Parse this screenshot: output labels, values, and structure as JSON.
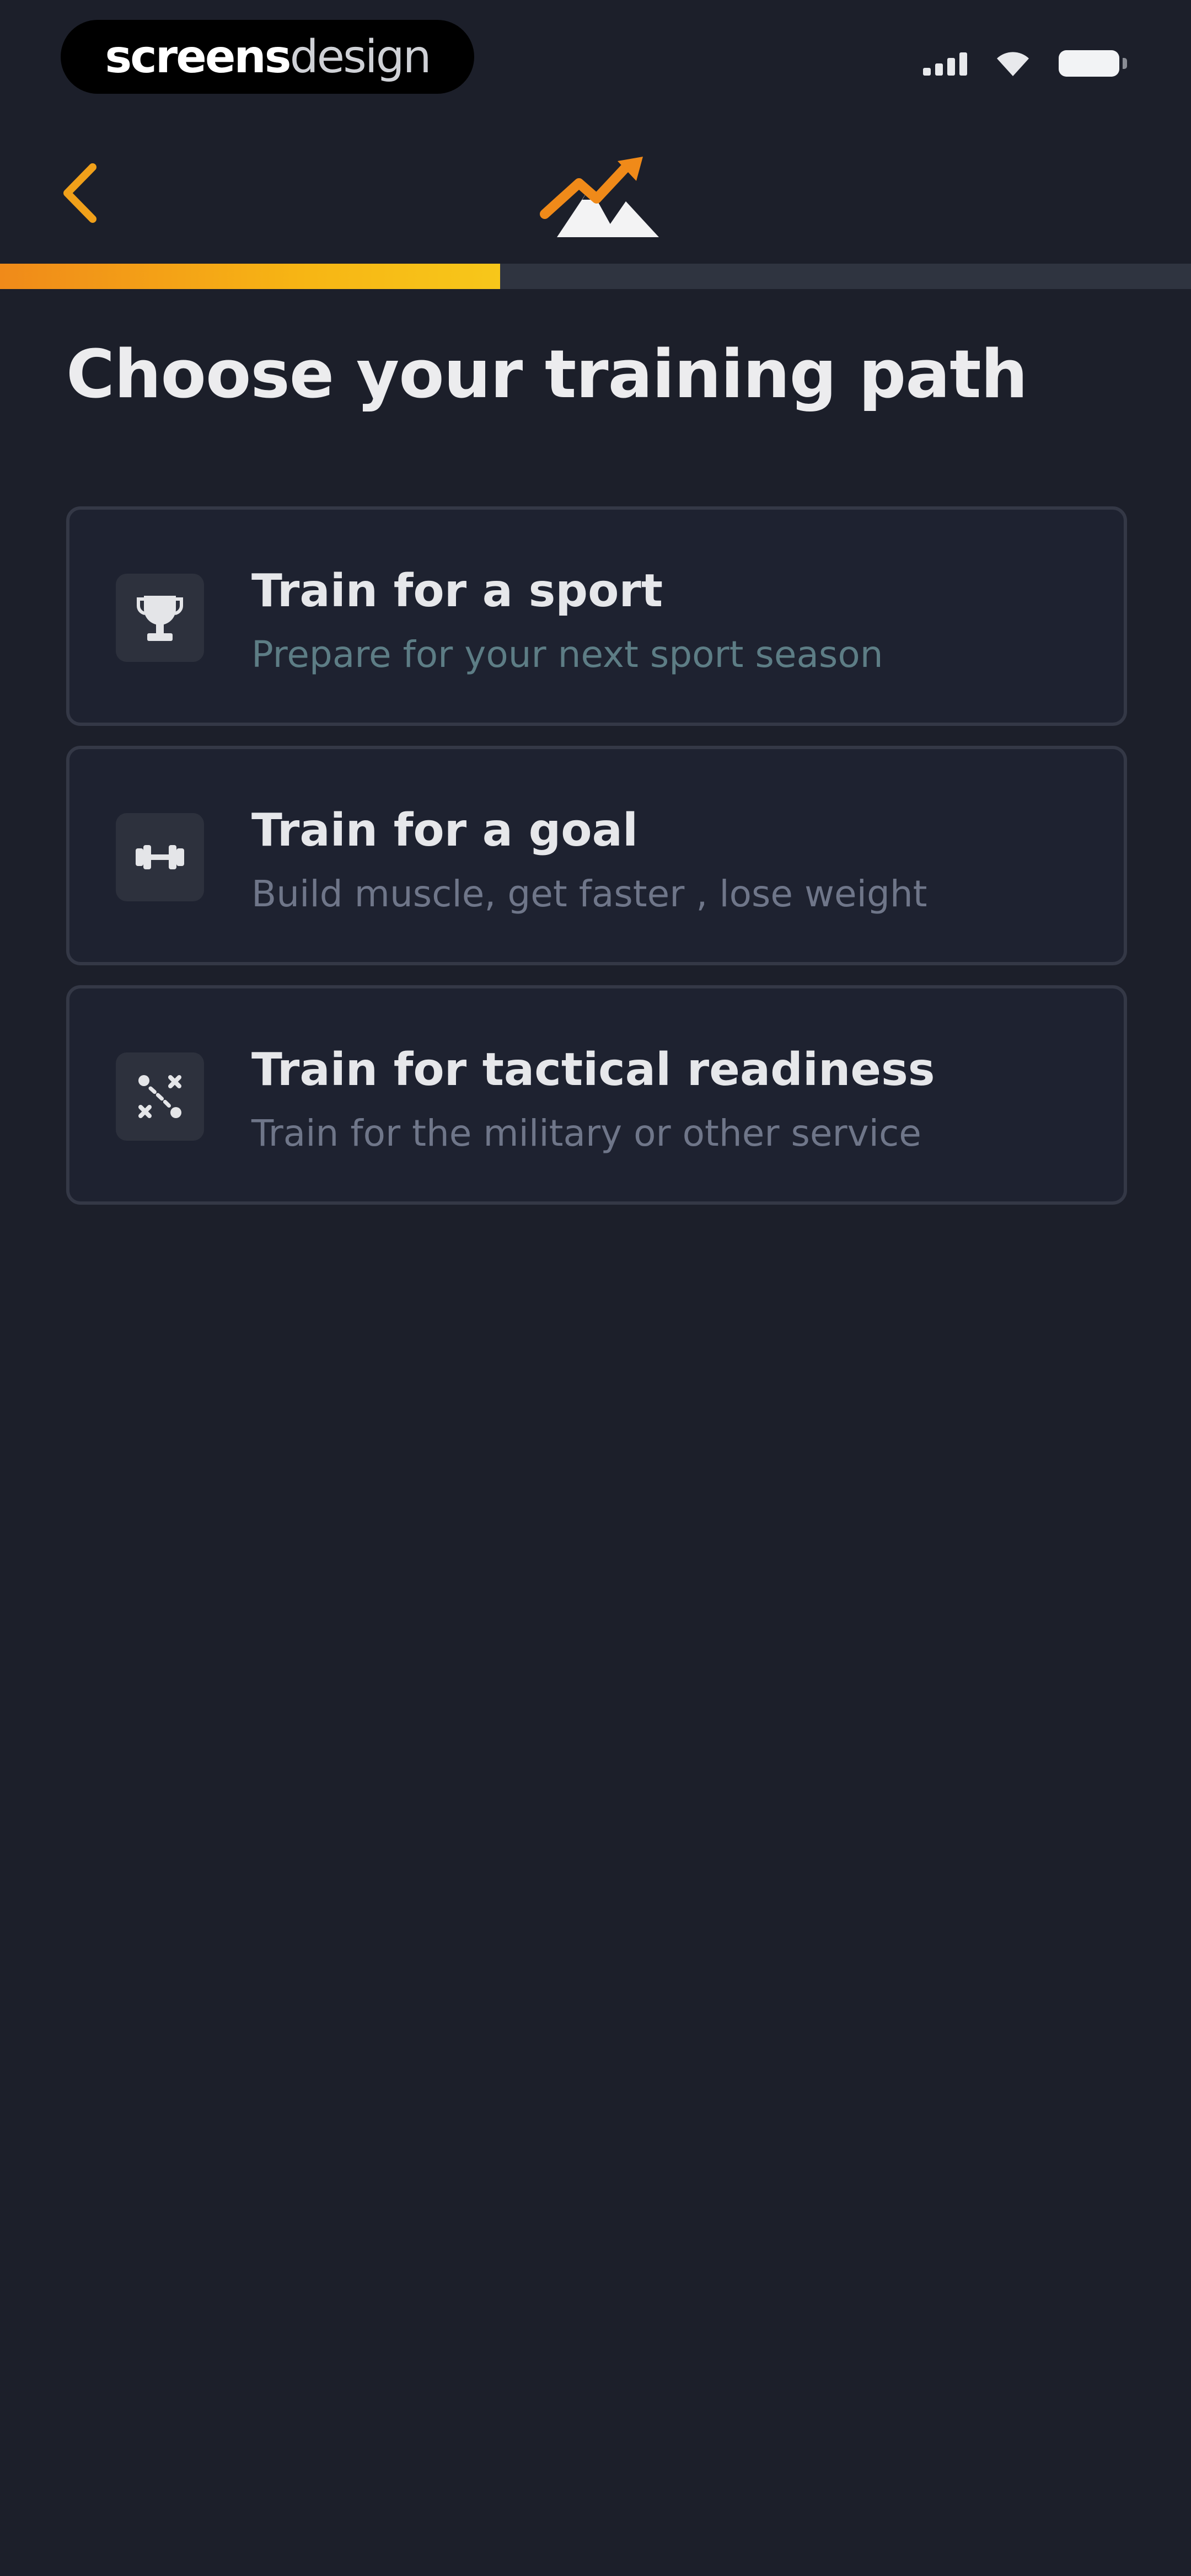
{
  "status_bar": {
    "watermark_bold": "screens",
    "watermark_light": "design",
    "icons": [
      "signal-icon",
      "wifi-icon",
      "battery-icon"
    ]
  },
  "header": {
    "back_icon": "chevron-left-icon",
    "logo_icon": "mountain-logo-icon",
    "accent_color": "#f0a01a"
  },
  "progress": {
    "fraction": 0.42
  },
  "page": {
    "title": "Choose your training path"
  },
  "options": [
    {
      "icon": "trophy-icon",
      "title": "Train for a sport",
      "subtitle": "Prepare for your next sport season"
    },
    {
      "icon": "dumbbell-icon",
      "title": "Train for a goal",
      "subtitle": "Build muscle, get faster , lose weight"
    },
    {
      "icon": "tactical-icon",
      "title": "Train for tactical readiness",
      "subtitle": "Train for the military or other service"
    }
  ]
}
